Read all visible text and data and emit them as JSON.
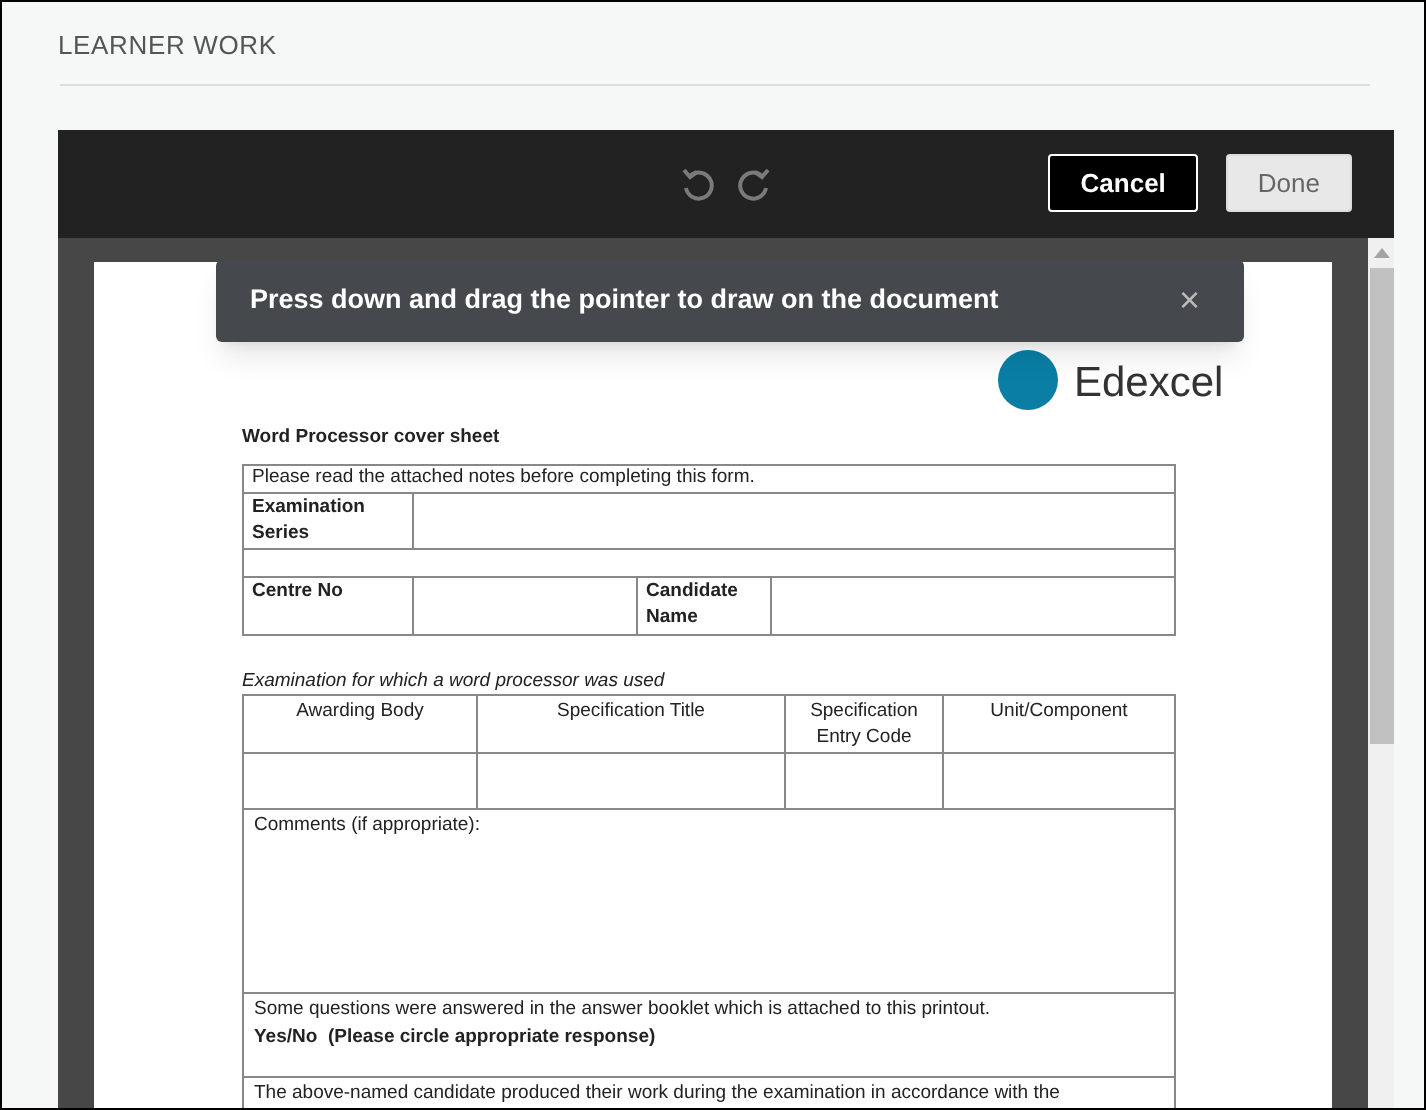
{
  "page_title": "LEARNER WORK",
  "toolbar": {
    "buttons": [
      {
        "label": "Cancel",
        "kind": "primary"
      },
      {
        "label": "Done",
        "kind": "secondary"
      }
    ]
  },
  "toast": {
    "message": "Press down and drag the pointer to draw on the document",
    "close": "×"
  },
  "document": {
    "logo_text": "Edexcel",
    "title": "Word Processor cover sheet",
    "notice": "Please read the attached notes before completing this form.",
    "examination_series_label": "Examination Series",
    "centre_no_label": "Centre No",
    "candidate_name_label": "Candidate Name",
    "exam_caption": "Examination for which a word processor was used",
    "columns": [
      "Awarding Body",
      "Specification Title",
      "Specification Entry Code",
      "Unit/Component"
    ],
    "comments_label": "Comments (if appropriate):",
    "booklet_note": "Some questions were answered in the answer booklet which is attached to this printout.",
    "booklet_response": "Yes/No  (Please circle appropriate response)",
    "declaration": "The above-named candidate produced their work during the examination in accordance with the"
  }
}
